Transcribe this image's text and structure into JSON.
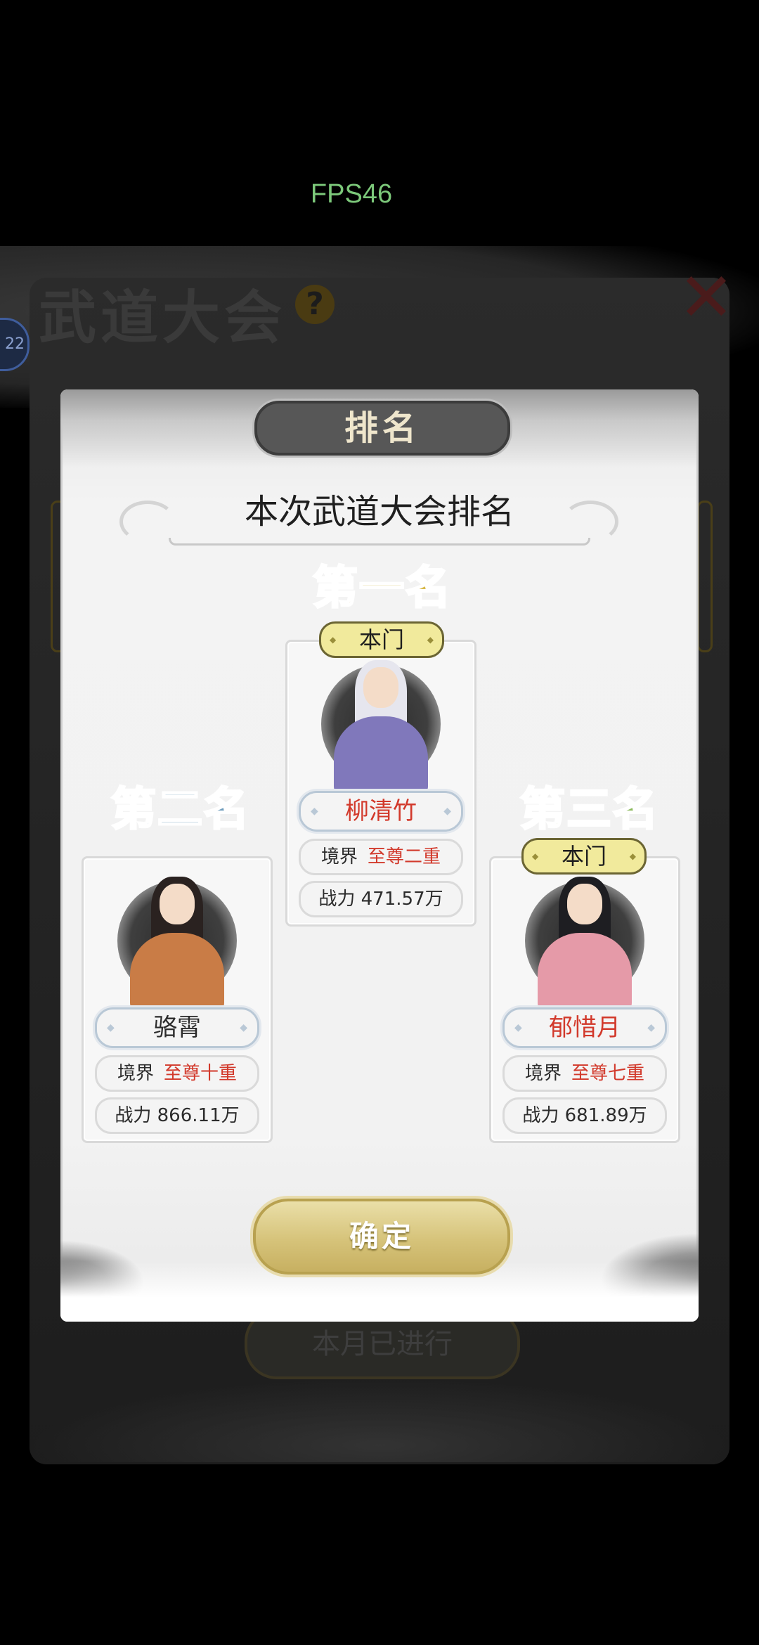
{
  "status": {
    "fps": "FPS46"
  },
  "background": {
    "title": "武道大会",
    "help_icon": "?",
    "close_icon": "✕",
    "badge": "22",
    "bottom_button": "本月已进行"
  },
  "popup": {
    "tab_title": "排名",
    "heading": "本次武道大会排名",
    "confirm_label": "确定",
    "rank_labels": [
      "第一名",
      "第二名",
      "第三名"
    ],
    "entries": [
      {
        "rank": "第一名",
        "tag": "本门",
        "name": "柳清竹",
        "realm_label": "境界",
        "realm_value": "至尊二重",
        "power": "战力 471.57万",
        "name_color": "#d2392b",
        "hair": "#e8e8ee",
        "robe": "#7f76b8"
      },
      {
        "rank": "第二名",
        "tag": "",
        "name": "骆霄",
        "realm_label": "境界",
        "realm_value": "至尊十重",
        "power": "战力 866.11万",
        "name_color": "#2b2b2b",
        "hair": "#2a2220",
        "robe": "#c97c46"
      },
      {
        "rank": "第三名",
        "tag": "本门",
        "name": "郁惜月",
        "realm_label": "境界",
        "realm_value": "至尊七重",
        "power": "战力 681.89万",
        "name_color": "#d2392b",
        "hair": "#1e1e22",
        "robe": "#e59aa8"
      }
    ]
  }
}
